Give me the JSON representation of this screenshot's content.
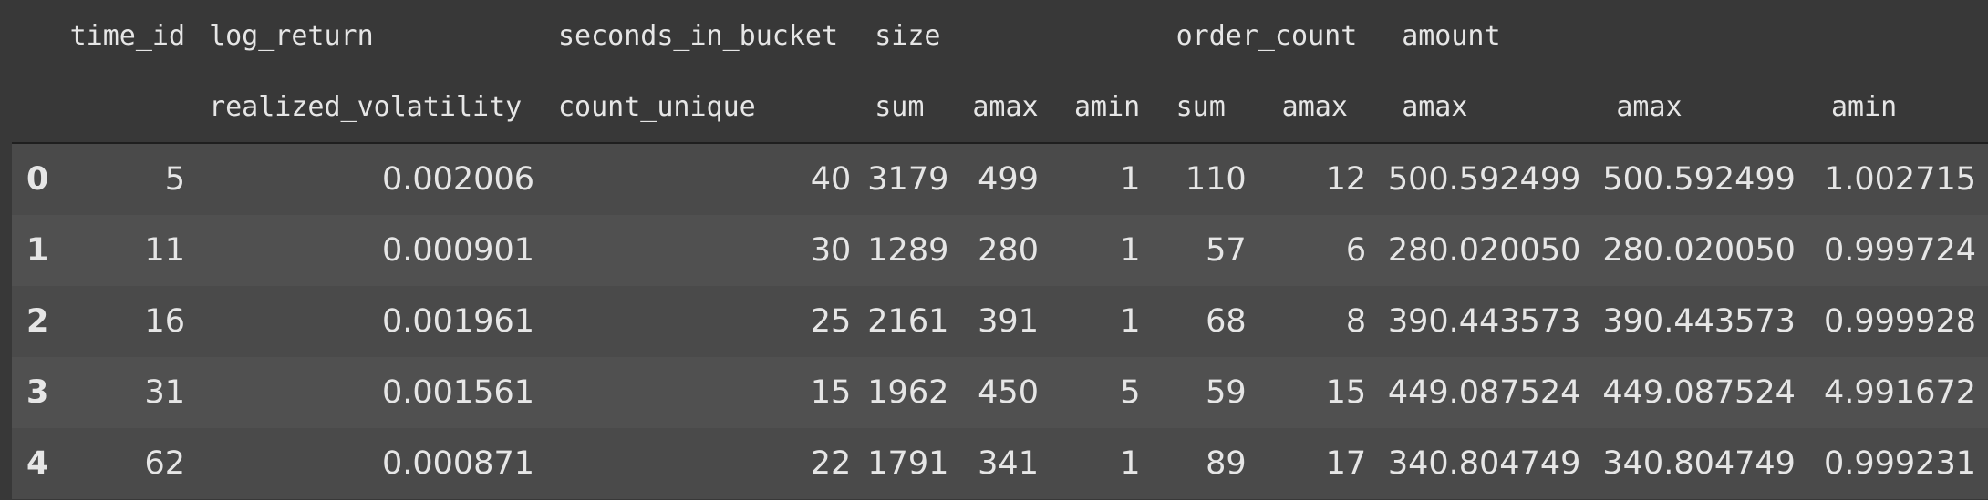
{
  "header": {
    "top": {
      "time_id": "time_id",
      "log_return": "log_return",
      "seconds_in_bucket": "seconds_in_bucket",
      "size": "size",
      "order_count": "order_count",
      "amount": "amount"
    },
    "sub": {
      "realized_volatility": "realized_volatility",
      "count_unique": "count_unique",
      "size_sum": "sum",
      "size_amax": "amax",
      "size_amin": "amin",
      "order_sum": "sum",
      "order_amax": "amax",
      "amount_amax1": "amax",
      "amount_amax2": "amax",
      "amount_amin": "amin"
    }
  },
  "rows": [
    {
      "idx": "0",
      "time_id": "5",
      "rv": "0.002006",
      "cu": "40",
      "ssum": "3179",
      "samax": "499",
      "samin": "1",
      "osum": "110",
      "oamax": "12",
      "a1": "500.592499",
      "a2": "500.592499",
      "a3": "1.002715"
    },
    {
      "idx": "1",
      "time_id": "11",
      "rv": "0.000901",
      "cu": "30",
      "ssum": "1289",
      "samax": "280",
      "samin": "1",
      "osum": "57",
      "oamax": "6",
      "a1": "280.020050",
      "a2": "280.020050",
      "a3": "0.999724"
    },
    {
      "idx": "2",
      "time_id": "16",
      "rv": "0.001961",
      "cu": "25",
      "ssum": "2161",
      "samax": "391",
      "samin": "1",
      "osum": "68",
      "oamax": "8",
      "a1": "390.443573",
      "a2": "390.443573",
      "a3": "0.999928"
    },
    {
      "idx": "3",
      "time_id": "31",
      "rv": "0.001561",
      "cu": "15",
      "ssum": "1962",
      "samax": "450",
      "samin": "5",
      "osum": "59",
      "oamax": "15",
      "a1": "449.087524",
      "a2": "449.087524",
      "a3": "4.991672"
    },
    {
      "idx": "4",
      "time_id": "62",
      "rv": "0.000871",
      "cu": "22",
      "ssum": "1791",
      "samax": "341",
      "samin": "1",
      "osum": "89",
      "oamax": "17",
      "a1": "340.804749",
      "a2": "340.804749",
      "a3": "0.999231"
    }
  ]
}
